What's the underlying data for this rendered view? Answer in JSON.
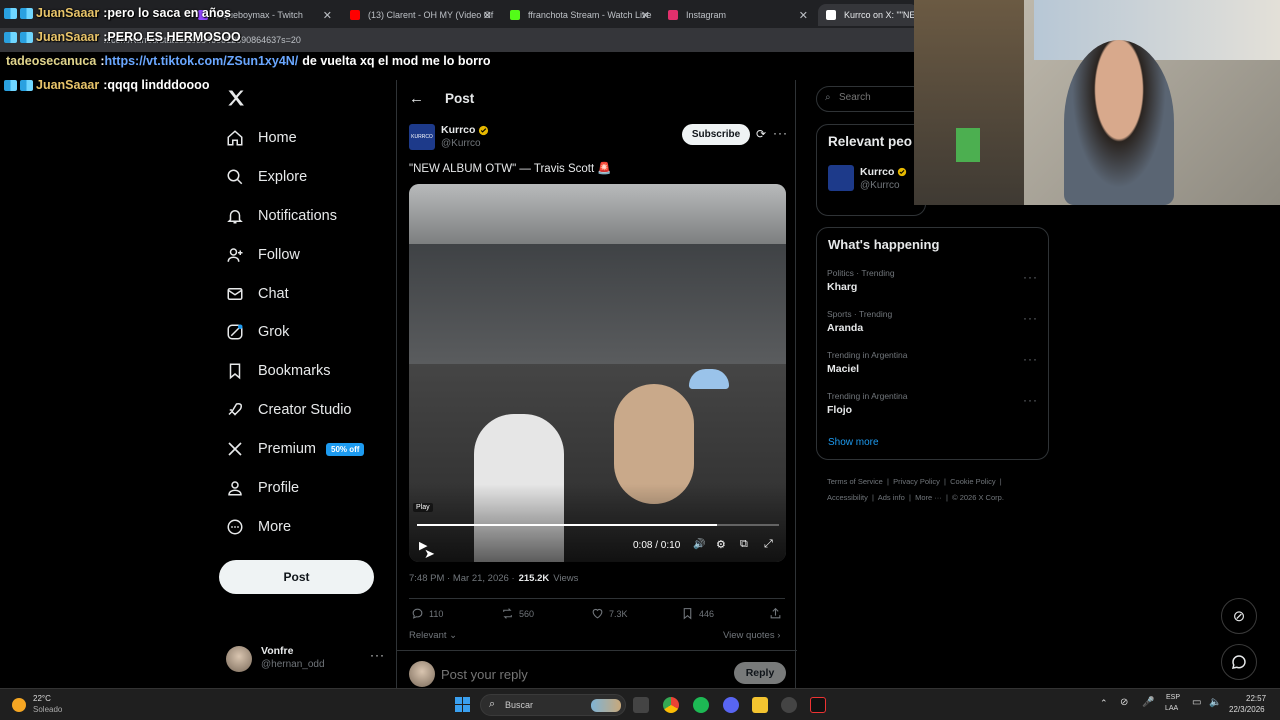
{
  "browser": {
    "tabs": [
      {
        "label": "laqueboymax - Twitch",
        "color": "#9146ff"
      },
      {
        "label": "(13) Clarent - OH MY (Video Of",
        "color": "#ff0000"
      },
      {
        "label": "ffranchota Stream - Watch Live",
        "color": "#53fc18"
      },
      {
        "label": "Instagram",
        "color": "#e1306c"
      },
      {
        "label": "Kurrco on X: \"\"NEW A",
        "color": "#ffffff"
      }
    ],
    "url": "x.com/Kurrco/status/2035466812690864637s=20"
  },
  "chat": [
    {
      "user": "JuanSaaar",
      "sep": " : ",
      "text": "pero lo saca en años"
    },
    {
      "user": "JuanSaaar",
      "sep": " : ",
      "text": "PERO ES HERMOSOO"
    },
    {
      "user": "tadeosecanuca",
      "sep": " : ",
      "link": "https://vt.tiktok.com/ZSun1xy4N/",
      "text": "de vuelta xq el mod me lo borro"
    },
    {
      "user": "JuanSaaar",
      "sep": " : ",
      "text": "qqqq lindddoooo"
    }
  ],
  "nav": {
    "items": [
      {
        "label": "Home",
        "icon": "home-icon"
      },
      {
        "label": "Explore",
        "icon": "search-icon"
      },
      {
        "label": "Notifications",
        "icon": "bell-icon"
      },
      {
        "label": "Follow",
        "icon": "follow-icon"
      },
      {
        "label": "Chat",
        "icon": "mail-icon"
      },
      {
        "label": "Grok",
        "icon": "grok-icon"
      },
      {
        "label": "Bookmarks",
        "icon": "bookmark-icon"
      },
      {
        "label": "Creator Studio",
        "icon": "rocket-icon"
      },
      {
        "label": "Premium",
        "icon": "x-logo-icon"
      },
      {
        "label": "Profile",
        "icon": "person-icon"
      },
      {
        "label": "More",
        "icon": "more-circle-icon"
      }
    ],
    "premium_badge": "50% off",
    "post_label": "Post",
    "account": {
      "name": "Vonfre",
      "handle": "@hernan_odd"
    }
  },
  "post": {
    "header_title": "Post",
    "author": "Kurrco",
    "handle": "@Kurrco",
    "subscribe_label": "Subscribe",
    "text": "\"NEW ALBUM OTW\" — Travis Scott 🚨",
    "video": {
      "play_tooltip": "Play",
      "time": "0:08 / 0:10",
      "progress": 0.83
    },
    "timestamp": "7:48 PM · Mar 21, 2026 ·",
    "views_count": "215.2K",
    "views_label": "Views",
    "replies": "110",
    "reposts": "560",
    "likes": "7.3K",
    "bookmarks": "446",
    "sort_label": "Relevant",
    "quotes_label": "View quotes",
    "reply_placeholder": "Post your reply",
    "reply_button": "Reply"
  },
  "sidebar": {
    "search_placeholder": "Search",
    "relevant_title": "Relevant peo",
    "relevant_user": {
      "name": "Kurrco",
      "handle": "@Kurrco"
    },
    "happening_title": "What's happening",
    "trends": [
      {
        "meta": "Politics · Trending",
        "name": "Kharg"
      },
      {
        "meta": "Sports · Trending",
        "name": "Aranda"
      },
      {
        "meta": "Trending in Argentina",
        "name": "Maciel"
      },
      {
        "meta": "Trending in Argentina",
        "name": "Flojo"
      }
    ],
    "show_more": "Show more",
    "footer": [
      "Terms of Service",
      "Privacy Policy",
      "Cookie Policy",
      "Accessibility",
      "Ads info",
      "More ···",
      "© 2026 X Corp."
    ]
  },
  "taskbar": {
    "weather_temp": "22°C",
    "weather_desc": "Soleado",
    "search_label": "Buscar",
    "lang": "ESP",
    "lang2": "LAA",
    "time": "22:57",
    "date": "22/3/2026"
  }
}
